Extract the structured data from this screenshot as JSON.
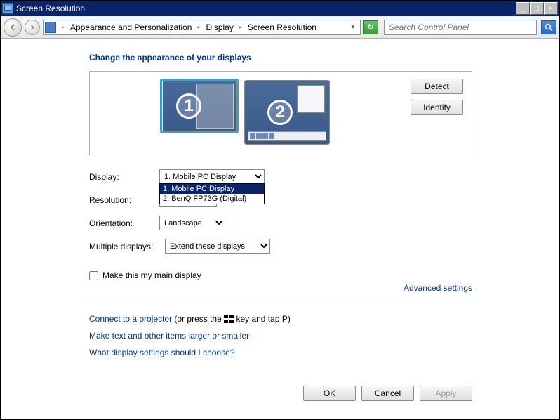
{
  "window": {
    "title": "Screen Resolution"
  },
  "nav": {
    "breadcrumb": [
      "Appearance and Personalization",
      "Display",
      "Screen Resolution"
    ],
    "search_placeholder": "Search Control Panel"
  },
  "heading": "Change the appearance of your displays",
  "monitors": {
    "primary_num": "1",
    "secondary_num": "2"
  },
  "box_buttons": {
    "detect": "Detect",
    "identify": "Identify"
  },
  "form": {
    "display_label": "Display:",
    "display_value": "1. Mobile PC Display",
    "display_options": [
      "1. Mobile PC Display",
      "2. BenQ FP73G (Digital)"
    ],
    "resolution_label": "Resolution:",
    "resolution_value": "",
    "orientation_label": "Orientation:",
    "orientation_value": "Landscape",
    "multiple_label": "Multiple displays:",
    "multiple_value": "Extend these displays"
  },
  "checkbox": {
    "label": "Make this my main display",
    "checked": false
  },
  "advanced_link": "Advanced settings",
  "links": {
    "projector_pre": "Connect to a projector",
    "projector_post": " (or press the ",
    "projector_end": " key and tap P)",
    "text_size": "Make text and other items larger or smaller",
    "help": "What display settings should I choose?"
  },
  "actions": {
    "ok": "OK",
    "cancel": "Cancel",
    "apply": "Apply"
  }
}
